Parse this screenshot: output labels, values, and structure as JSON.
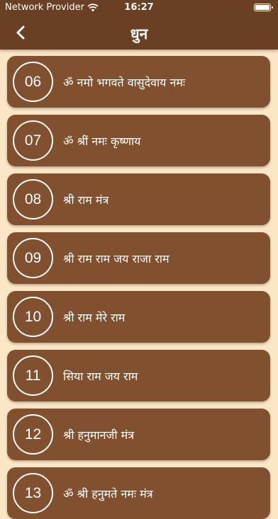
{
  "status_bar": {
    "carrier": "Network Provider",
    "time": "16:27"
  },
  "header": {
    "title": "धुन",
    "back_icon": "chevron-left-icon"
  },
  "colors": {
    "header_bg": "#6b3f24",
    "card_bg": "#80502f",
    "page_bg": "#fbe6c6",
    "text": "#ffffff"
  },
  "items": [
    {
      "number": "06",
      "label": "ॐ नमो भगवते वासुदेवाय नमः"
    },
    {
      "number": "07",
      "label": "ॐ श्रीं नमः कृष्णाय"
    },
    {
      "number": "08",
      "label": "श्री राम मंत्र"
    },
    {
      "number": "09",
      "label": "श्री राम राम जय राजा राम"
    },
    {
      "number": "10",
      "label": "श्री राम मेरे राम"
    },
    {
      "number": "11",
      "label": "सिया राम जय राम"
    },
    {
      "number": "12",
      "label": "श्री हनुमानजी मंत्र"
    },
    {
      "number": "13",
      "label": "ॐ श्री हनुमते नमः मंत्र"
    }
  ]
}
